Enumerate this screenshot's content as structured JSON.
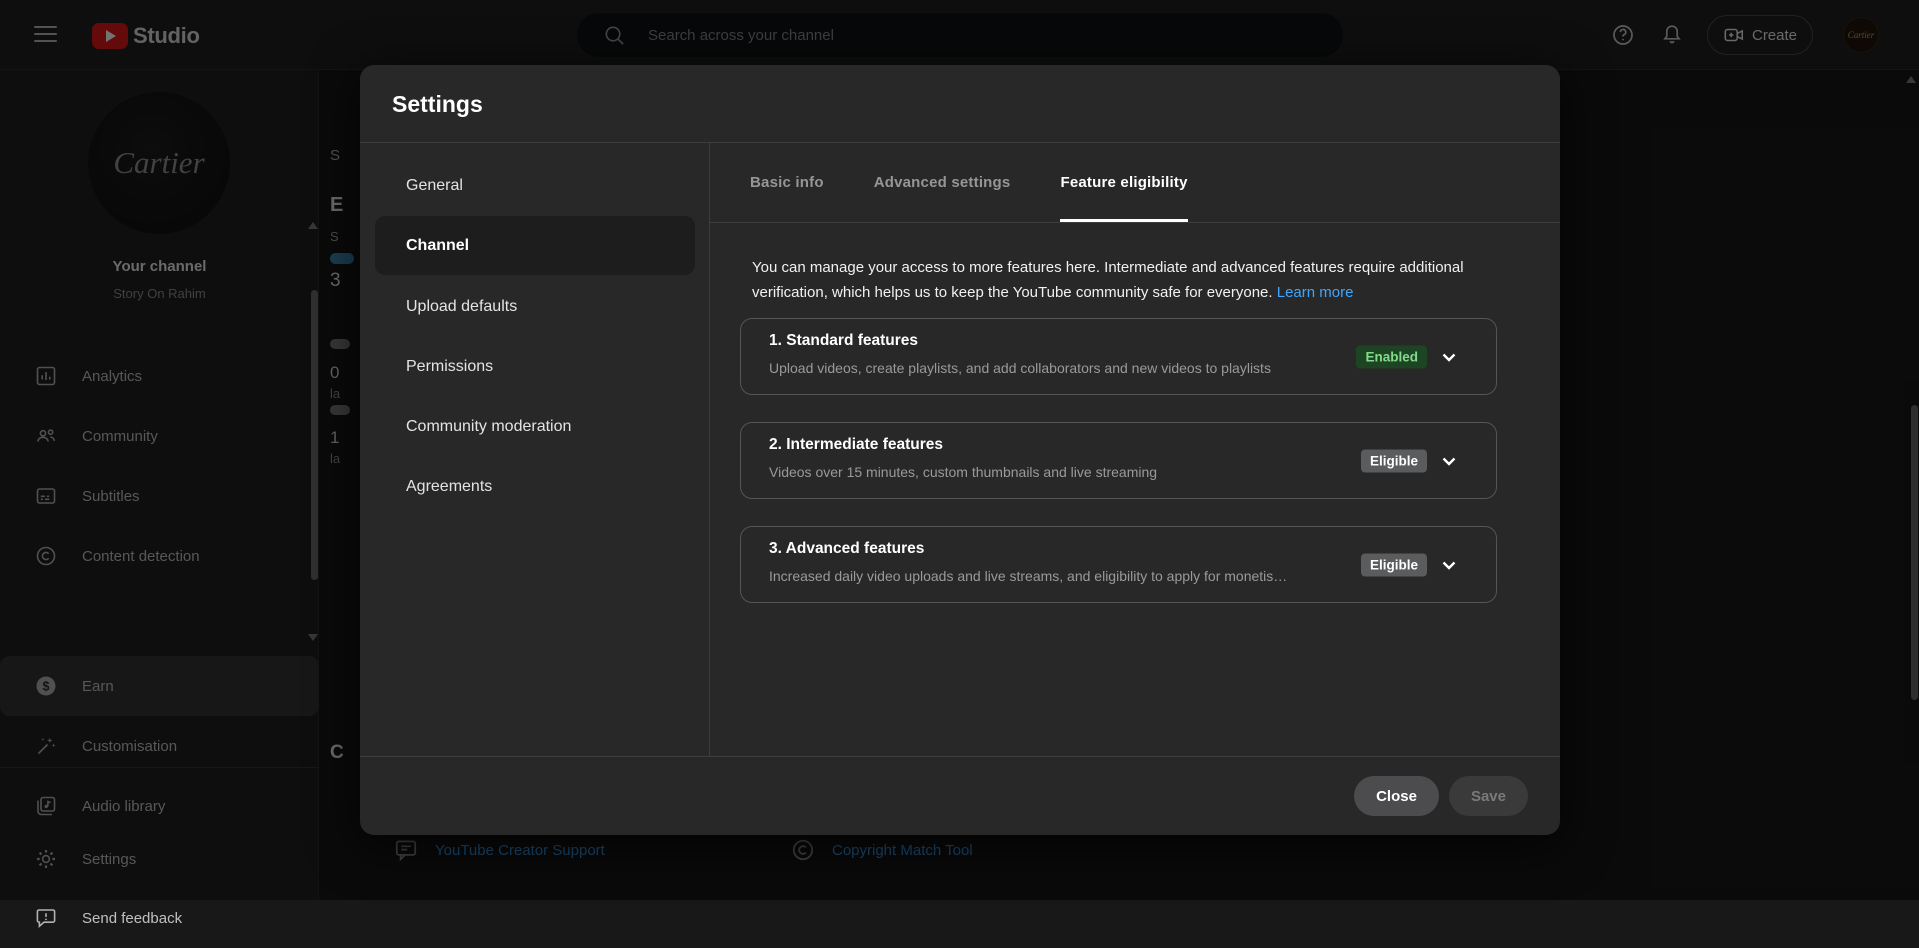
{
  "topbar": {
    "product_name": "Studio",
    "search_placeholder": "Search across your channel",
    "create_label": "Create",
    "avatar_label": "Cartier"
  },
  "sidebar": {
    "channel_avatar_text": "Cartier",
    "channel_title": "Your channel",
    "channel_subtitle": "Story On Rahim",
    "items": [
      {
        "label": "Analytics",
        "icon": "analytics-icon"
      },
      {
        "label": "Community",
        "icon": "community-icon"
      },
      {
        "label": "Subtitles",
        "icon": "subtitles-icon"
      },
      {
        "label": "Content detection",
        "icon": "copyright-icon"
      },
      {
        "label": "Earn",
        "icon": "dollar-icon",
        "active": true
      },
      {
        "label": "Customisation",
        "icon": "wand-icon"
      },
      {
        "label": "Audio library",
        "icon": "audio-library-icon"
      },
      {
        "label": "Settings",
        "icon": "gear-icon"
      },
      {
        "label": "Send feedback",
        "icon": "feedback-icon"
      }
    ]
  },
  "background": {
    "fragments": [
      "S",
      "E",
      "S",
      "3",
      "0",
      "la",
      "1",
      "la",
      "C"
    ],
    "links": [
      {
        "label": "YouTube Creator Support",
        "icon": "chat-bubble-icon"
      },
      {
        "label": "Copyright Match Tool",
        "icon": "copyright-icon"
      }
    ]
  },
  "modal": {
    "title": "Settings",
    "nav": [
      {
        "label": "General"
      },
      {
        "label": "Channel",
        "active": true
      },
      {
        "label": "Upload defaults"
      },
      {
        "label": "Permissions"
      },
      {
        "label": "Community moderation"
      },
      {
        "label": "Agreements"
      }
    ],
    "tabs": [
      {
        "label": "Basic info"
      },
      {
        "label": "Advanced settings"
      },
      {
        "label": "Feature eligibility",
        "active": true
      }
    ],
    "description": {
      "text": "You can manage your access to more features here. Intermediate and advanced features require additional verification, which helps us to keep the YouTube community safe for everyone.",
      "link": "Learn more"
    },
    "features": [
      {
        "title": "1. Standard features",
        "description": "Upload videos, create playlists, and add collaborators and new videos to playlists",
        "badge": "Enabled",
        "badge_type": "enabled"
      },
      {
        "title": "2. Intermediate features",
        "description": "Videos over 15 minutes, custom thumbnails and live streaming",
        "badge": "Eligible",
        "badge_type": "eligible"
      },
      {
        "title": "3. Advanced features",
        "description": "Increased daily video uploads and live streams, and eligibility to apply for monetis…",
        "badge": "Eligible",
        "badge_type": "eligible"
      }
    ],
    "footer": {
      "close_label": "Close",
      "save_label": "Save"
    }
  },
  "colors": {
    "brand_red": "#e01818",
    "link_blue": "#3ea6ff",
    "badge_enabled_bg": "#1e4523",
    "badge_enabled_text": "#83d98c",
    "badge_eligible_bg": "#5a5c5e",
    "modal_bg": "#282828",
    "tab_underline": "#ffffff"
  }
}
